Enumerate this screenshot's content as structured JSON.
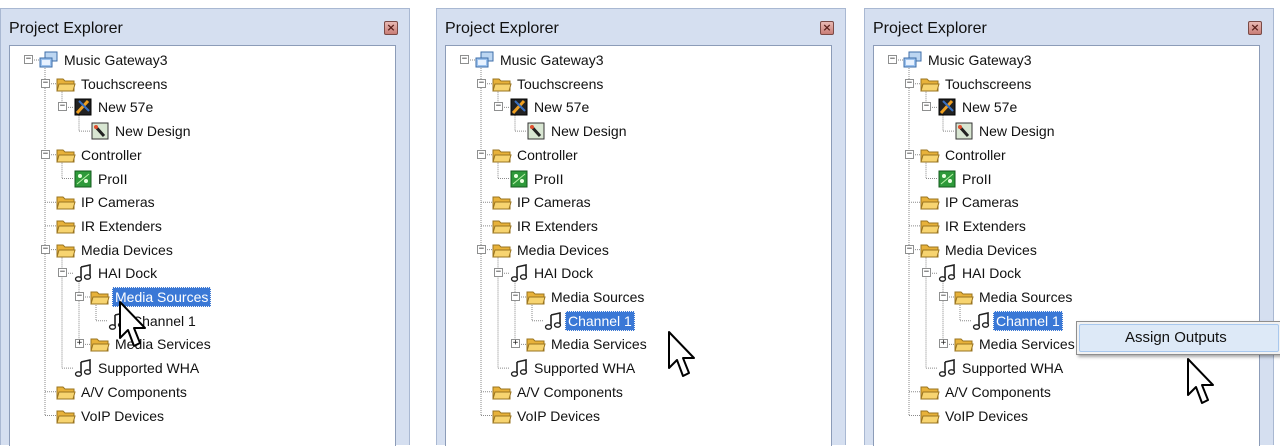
{
  "panels": [
    {
      "title": "Project Explorer",
      "tree": [
        {
          "label": "Music Gateway3",
          "level": 0,
          "icon": "computer-network-icon",
          "expander": "minus"
        },
        {
          "label": "Touchscreens",
          "level": 1,
          "icon": "folder-icon",
          "expander": "minus"
        },
        {
          "label": "New 57e",
          "level": 2,
          "icon": "touchscreen-device-icon",
          "expander": "minus"
        },
        {
          "label": "New Design",
          "level": 3,
          "icon": "design-icon",
          "expander": ""
        },
        {
          "label": "Controller",
          "level": 1,
          "icon": "folder-icon",
          "expander": "minus"
        },
        {
          "label": "ProII",
          "level": 2,
          "icon": "controller-board-icon",
          "expander": ""
        },
        {
          "label": "IP Cameras",
          "level": 1,
          "icon": "folder-icon",
          "expander": ""
        },
        {
          "label": "IR Extenders",
          "level": 1,
          "icon": "folder-icon",
          "expander": ""
        },
        {
          "label": "Media Devices",
          "level": 1,
          "icon": "folder-icon",
          "expander": "minus"
        },
        {
          "label": "HAI Dock",
          "level": 2,
          "icon": "music-note-icon",
          "expander": "minus"
        },
        {
          "label": "Media Sources",
          "level": 3,
          "icon": "folder-icon",
          "expander": "minus"
        },
        {
          "label": "Channel 1",
          "level": 4,
          "icon": "music-note-icon",
          "expander": ""
        },
        {
          "label": "Media Services",
          "level": 3,
          "icon": "folder-icon",
          "expander": "plus"
        },
        {
          "label": "Supported WHA",
          "level": 2,
          "icon": "music-note-icon",
          "expander": ""
        },
        {
          "label": "A/V Components",
          "level": 1,
          "icon": "folder-icon",
          "expander": ""
        },
        {
          "label": "VoIP Devices",
          "level": 1,
          "icon": "folder-icon",
          "expander": ""
        }
      ],
      "selected_label": "Media Sources"
    },
    {
      "title": "Project Explorer",
      "tree": [
        {
          "label": "Music Gateway3",
          "level": 0,
          "icon": "computer-network-icon",
          "expander": "minus"
        },
        {
          "label": "Touchscreens",
          "level": 1,
          "icon": "folder-icon",
          "expander": "minus"
        },
        {
          "label": "New 57e",
          "level": 2,
          "icon": "touchscreen-device-icon",
          "expander": "minus"
        },
        {
          "label": "New Design",
          "level": 3,
          "icon": "design-icon",
          "expander": ""
        },
        {
          "label": "Controller",
          "level": 1,
          "icon": "folder-icon",
          "expander": "minus"
        },
        {
          "label": "ProII",
          "level": 2,
          "icon": "controller-board-icon",
          "expander": ""
        },
        {
          "label": "IP Cameras",
          "level": 1,
          "icon": "folder-icon",
          "expander": ""
        },
        {
          "label": "IR Extenders",
          "level": 1,
          "icon": "folder-icon",
          "expander": ""
        },
        {
          "label": "Media Devices",
          "level": 1,
          "icon": "folder-icon",
          "expander": "minus"
        },
        {
          "label": "HAI Dock",
          "level": 2,
          "icon": "music-note-icon",
          "expander": "minus"
        },
        {
          "label": "Media Sources",
          "level": 3,
          "icon": "folder-icon",
          "expander": "minus"
        },
        {
          "label": "Channel 1",
          "level": 4,
          "icon": "music-note-icon",
          "expander": ""
        },
        {
          "label": "Media Services",
          "level": 3,
          "icon": "folder-icon",
          "expander": "plus"
        },
        {
          "label": "Supported WHA",
          "level": 2,
          "icon": "music-note-icon",
          "expander": ""
        },
        {
          "label": "A/V Components",
          "level": 1,
          "icon": "folder-icon",
          "expander": ""
        },
        {
          "label": "VoIP Devices",
          "level": 1,
          "icon": "folder-icon",
          "expander": ""
        }
      ],
      "selected_label": "Channel 1"
    },
    {
      "title": "Project Explorer",
      "tree": [
        {
          "label": "Music Gateway3",
          "level": 0,
          "icon": "computer-network-icon",
          "expander": "minus"
        },
        {
          "label": "Touchscreens",
          "level": 1,
          "icon": "folder-icon",
          "expander": "minus"
        },
        {
          "label": "New 57e",
          "level": 2,
          "icon": "touchscreen-device-icon",
          "expander": "minus"
        },
        {
          "label": "New Design",
          "level": 3,
          "icon": "design-icon",
          "expander": ""
        },
        {
          "label": "Controller",
          "level": 1,
          "icon": "folder-icon",
          "expander": "minus"
        },
        {
          "label": "ProII",
          "level": 2,
          "icon": "controller-board-icon",
          "expander": ""
        },
        {
          "label": "IP Cameras",
          "level": 1,
          "icon": "folder-icon",
          "expander": ""
        },
        {
          "label": "IR Extenders",
          "level": 1,
          "icon": "folder-icon",
          "expander": ""
        },
        {
          "label": "Media Devices",
          "level": 1,
          "icon": "folder-icon",
          "expander": "minus"
        },
        {
          "label": "HAI Dock",
          "level": 2,
          "icon": "music-note-icon",
          "expander": "minus"
        },
        {
          "label": "Media Sources",
          "level": 3,
          "icon": "folder-icon",
          "expander": "minus"
        },
        {
          "label": "Channel 1",
          "level": 4,
          "icon": "music-note-icon",
          "expander": ""
        },
        {
          "label": "Media Services",
          "level": 3,
          "icon": "folder-icon",
          "expander": "plus"
        },
        {
          "label": "Supported WHA",
          "level": 2,
          "icon": "music-note-icon",
          "expander": ""
        },
        {
          "label": "A/V Components",
          "level": 1,
          "icon": "folder-icon",
          "expander": ""
        },
        {
          "label": "VoIP Devices",
          "level": 1,
          "icon": "folder-icon",
          "expander": ""
        }
      ],
      "selected_label": "Channel 1"
    }
  ],
  "context_menu": {
    "item": "Assign Outputs"
  },
  "colors": {
    "panel_background": "#d5dff0",
    "selection": "#3a78d6",
    "folder": "#f0c24d",
    "close_button": "#c97e77"
  }
}
